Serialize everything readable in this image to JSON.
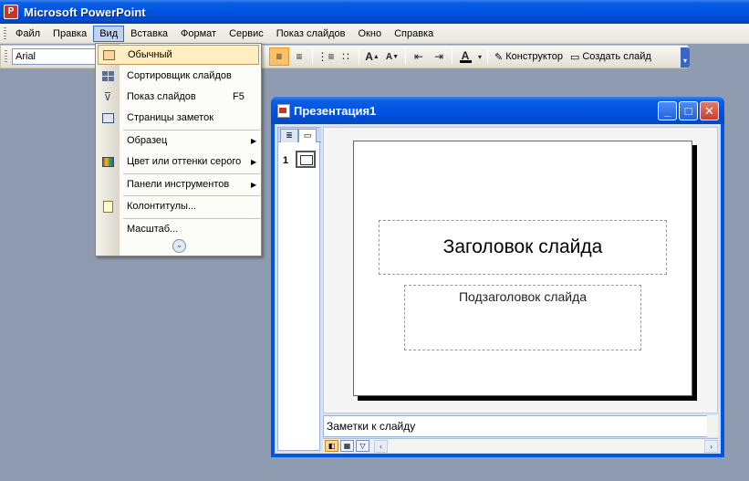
{
  "app": {
    "title": "Microsoft PowerPoint",
    "icon": "P"
  },
  "menubar": {
    "items": [
      "Файл",
      "Правка",
      "Вид",
      "Вставка",
      "Формат",
      "Сервис",
      "Показ слайдов",
      "Окно",
      "Справка"
    ],
    "active": "Вид"
  },
  "toolbar": {
    "font": "Arial",
    "constructor_label": "Конструктор",
    "new_slide_label": "Создать слайд",
    "icons": [
      "align-left-icon",
      "align-center-icon",
      "numbered-list-icon",
      "bulleted-list-icon",
      "increase-font-icon",
      "decrease-font-icon",
      "decrease-indent-icon",
      "increase-indent-icon",
      "font-color-icon"
    ]
  },
  "view_menu": {
    "items": [
      {
        "label": "Обычный",
        "icon": "normal-view-icon",
        "highlighted": true
      },
      {
        "label": "Сортировщик слайдов",
        "icon": "slide-sorter-icon"
      },
      {
        "label": "Показ слайдов",
        "icon": "slide-show-icon",
        "shortcut": "F5"
      },
      {
        "label": "Страницы заметок",
        "icon": "notes-page-icon"
      },
      {
        "label": "Образец",
        "submenu": true
      },
      {
        "label": "Цвет или оттенки серого",
        "icon": "color-grayscale-icon",
        "submenu": true
      },
      {
        "label": "Панели инструментов",
        "submenu": true
      },
      {
        "label": "Колонтитулы...",
        "icon": "header-footer-icon"
      },
      {
        "label": "Масштаб..."
      }
    ]
  },
  "presentation": {
    "title": "Презентация1",
    "slide_number": "1",
    "slide_title": "Заголовок слайда",
    "slide_subtitle": "Подзаголовок слайда",
    "notes_placeholder": "Заметки к слайду"
  },
  "colors": {
    "title_bar": "#0054e3",
    "desktop": "#8f9bb0",
    "menu_highlight": "#ffeec2"
  }
}
